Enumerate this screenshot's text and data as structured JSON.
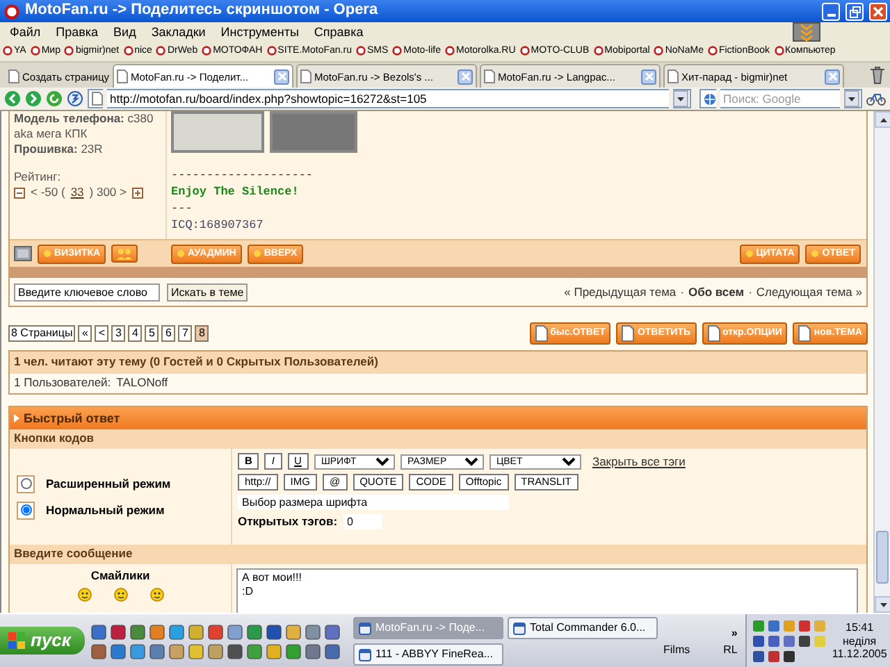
{
  "window": {
    "title": "MotoFan.ru -> Поделитесь скриншотом - Opera"
  },
  "menu": [
    "Файл",
    "Правка",
    "Вид",
    "Закладки",
    "Инструменты",
    "Справка"
  ],
  "bookmarks": [
    "YA",
    "Мир",
    "bigmir)net",
    "nice",
    "DrWeb",
    "МОТОФАН",
    "SITE.MotoFan.ru",
    "SMS",
    "Moto-life",
    "Motorolka.RU",
    "MOTO-CLUB",
    "Mobiportal",
    "NoNaMe",
    "FictionBook",
    "Компьютер"
  ],
  "tabs": [
    {
      "kind": "new",
      "label": "Создать страницу",
      "selected": false
    },
    {
      "kind": "page",
      "label": "MotoFan.ru -> Поделит...",
      "selected": true
    },
    {
      "kind": "page",
      "label": "MotoFan.ru -> Bezols's ...",
      "selected": false
    },
    {
      "kind": "page",
      "label": "MotoFan.ru -> Langpac...",
      "selected": false
    },
    {
      "kind": "page",
      "label": "Хит-парад - bigmir)net",
      "selected": false
    }
  ],
  "address": {
    "url": "http://motofan.ru/board/index.php?showtopic=16272&st=105"
  },
  "search": {
    "placeholder": "Поиск: Google"
  },
  "post": {
    "profile": [
      "**Модель телефона:** c380",
      "aka мега КПК",
      "**Прошивка:** 23R"
    ],
    "rating_label": "Рейтинг:",
    "rating": {
      "low": "< -50 (",
      "score": "33",
      "high": ") 300 >"
    },
    "signature": {
      "divider": "--------------------",
      "motto": "Enjoy The Silence!",
      "separator": "---",
      "icq": "ICQ:168907367"
    }
  },
  "post_buttons": {
    "left": [
      "ВИЗИТКА"
    ],
    "middle": [
      "АУАДМИН",
      "ВВЕРХ"
    ],
    "right": [
      "ЦИТАТА",
      "ОТВЕТ"
    ]
  },
  "topic_search": {
    "value": "Введите ключевое слово",
    "button": "Искать в теме"
  },
  "topic_nav": [
    {
      "kind": "link",
      "text": "« Предыдущая тема"
    },
    {
      "kind": "sep",
      "text": "·"
    },
    {
      "kind": "current",
      "text": "Обо всем"
    },
    {
      "kind": "sep",
      "text": "·"
    },
    {
      "kind": "link",
      "text": "Следующая тема »"
    }
  ],
  "pagination": {
    "label": "8 Страницы",
    "pages": [
      {
        "text": "«",
        "selected": false
      },
      {
        "text": "<",
        "selected": false
      },
      {
        "text": "3",
        "selected": false
      },
      {
        "text": "4",
        "selected": false
      },
      {
        "text": "5",
        "selected": false
      },
      {
        "text": "6",
        "selected": false
      },
      {
        "text": "7",
        "selected": false
      },
      {
        "text": "8",
        "selected": true
      }
    ]
  },
  "topic_actions": [
    "быс.ОТВЕТ",
    "ОТВЕТИТЬ",
    "откр.ОПЦИИ",
    "нов.ТЕМА"
  ],
  "readers": {
    "title": "1 чел. читают эту тему (0 Гостей и 0 Скрытых Пользователей)",
    "users_label": "1 Пользователей:",
    "users": [
      "TALONoff"
    ]
  },
  "quick_reply": {
    "title": "Быстрый ответ",
    "code_buttons_title": "Кнопки кодов",
    "modes": [
      {
        "label": "Расширенный режим",
        "selected": false
      },
      {
        "label": "Нормальный режим",
        "selected": true
      }
    ],
    "format_buttons": [
      "B",
      "I",
      "U"
    ],
    "selects": [
      "ШРИФТ",
      "РАЗМЕР",
      "ЦВЕТ"
    ],
    "close_tags": "Закрыть все тэги",
    "tag_buttons": [
      "http://",
      "IMG",
      "@",
      "QUOTE",
      "CODE",
      "Offtopic",
      "TRANSLIT"
    ],
    "hint_field": {
      "value": "Выбор размера шрифта"
    },
    "open_tags_label": "Открытых тэгов:",
    "open_tags": "0",
    "message_title": "Введите сообщение",
    "smilies_title": "Смайлики",
    "message": "А вот мои!!!\n:D"
  },
  "taskbar": {
    "start": "пуск",
    "windows": [
      {
        "label": "MotoFan.ru -> Поде...",
        "selected": true
      },
      {
        "label": "Total Commander 6.0...",
        "selected": false
      },
      {
        "label": "111 - ABBYY FineRea...",
        "selected": false
      }
    ],
    "more": "»",
    "toolbars": [
      "Films",
      "RL"
    ],
    "clock": {
      "time": "15:41",
      "day": "неділя",
      "date": "11.12.2005"
    }
  }
}
